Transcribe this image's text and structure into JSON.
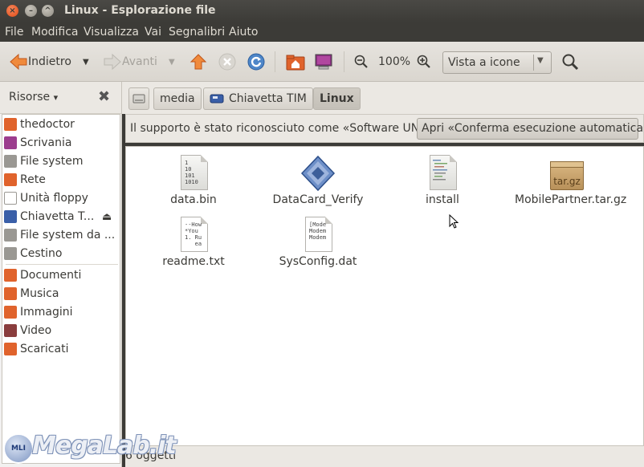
{
  "window": {
    "title": "Linux - Esplorazione file",
    "close_glyph": "×",
    "min_glyph": "–",
    "max_glyph": "^"
  },
  "menubar": [
    "File",
    "Modifica",
    "Visualizza",
    "Vai",
    "Segnalibri",
    "Aiuto"
  ],
  "toolbar": {
    "back_label": "Indietro",
    "forward_label": "Avanti",
    "zoom_level": "100%",
    "view_mode": "Vista a icone"
  },
  "sidebar": {
    "title": "Risorse",
    "title_arrow": "▾",
    "close_glyph": "✖",
    "eject_glyph": "⏏",
    "items": [
      {
        "label": "thedoctor",
        "icon": "home-folder-icon",
        "color": "#e0632c"
      },
      {
        "label": "Scrivania",
        "icon": "desktop-folder-icon",
        "color": "#9c3d8e"
      },
      {
        "label": "File system",
        "icon": "drive-icon",
        "color": "#9a9893"
      },
      {
        "label": "Rete",
        "icon": "network-folder-icon",
        "color": "#e0632c"
      },
      {
        "label": "Unità floppy",
        "icon": "floppy-icon",
        "color": "#c8c6c1"
      },
      {
        "label": "Chiavetta T...",
        "icon": "usb-modem-icon",
        "color": "#3a5fa8"
      },
      {
        "label": "File system da ...",
        "icon": "drive-icon",
        "color": "#9a9893"
      },
      {
        "label": "Cestino",
        "icon": "trash-icon",
        "color": "#9a9893"
      },
      {
        "label": "Documenti",
        "icon": "documents-folder-icon",
        "color": "#e0632c"
      },
      {
        "label": "Musica",
        "icon": "music-folder-icon",
        "color": "#e0632c"
      },
      {
        "label": "Immagini",
        "icon": "pictures-folder-icon",
        "color": "#e0632c"
      },
      {
        "label": "Video",
        "icon": "videos-folder-icon",
        "color": "#8a3d3d"
      },
      {
        "label": "Scaricati",
        "icon": "downloads-folder-icon",
        "color": "#e0632c"
      }
    ]
  },
  "pathbar": {
    "crumbs": [
      "media",
      "Chiavetta TIM",
      "Linux"
    ]
  },
  "infobar": {
    "message": "Il supporto è stato riconosciuto come «Software UNI...",
    "button_label": "Apri «Conferma esecuzione automatica»"
  },
  "files": [
    {
      "name": "data.bin",
      "icon": "binary-file-icon",
      "preview": "1\n10\n101\n1010"
    },
    {
      "name": "DataCard_Verify",
      "icon": "executable-icon",
      "preview": ""
    },
    {
      "name": "install",
      "icon": "script-file-icon",
      "preview": ""
    },
    {
      "name": "MobilePartner.tar.gz",
      "icon": "archive-icon",
      "preview": "tar.gz"
    },
    {
      "name": "readme.txt",
      "icon": "text-file-icon",
      "preview": "--How\n*You\n1. Ru\n   ea"
    },
    {
      "name": "SysConfig.dat",
      "icon": "data-file-icon",
      "preview": "[Mode\nModem\nModem"
    }
  ],
  "status": {
    "text": "6 oggetti"
  },
  "watermark": {
    "text": "MegaLab.it",
    "badge": "MLI"
  }
}
